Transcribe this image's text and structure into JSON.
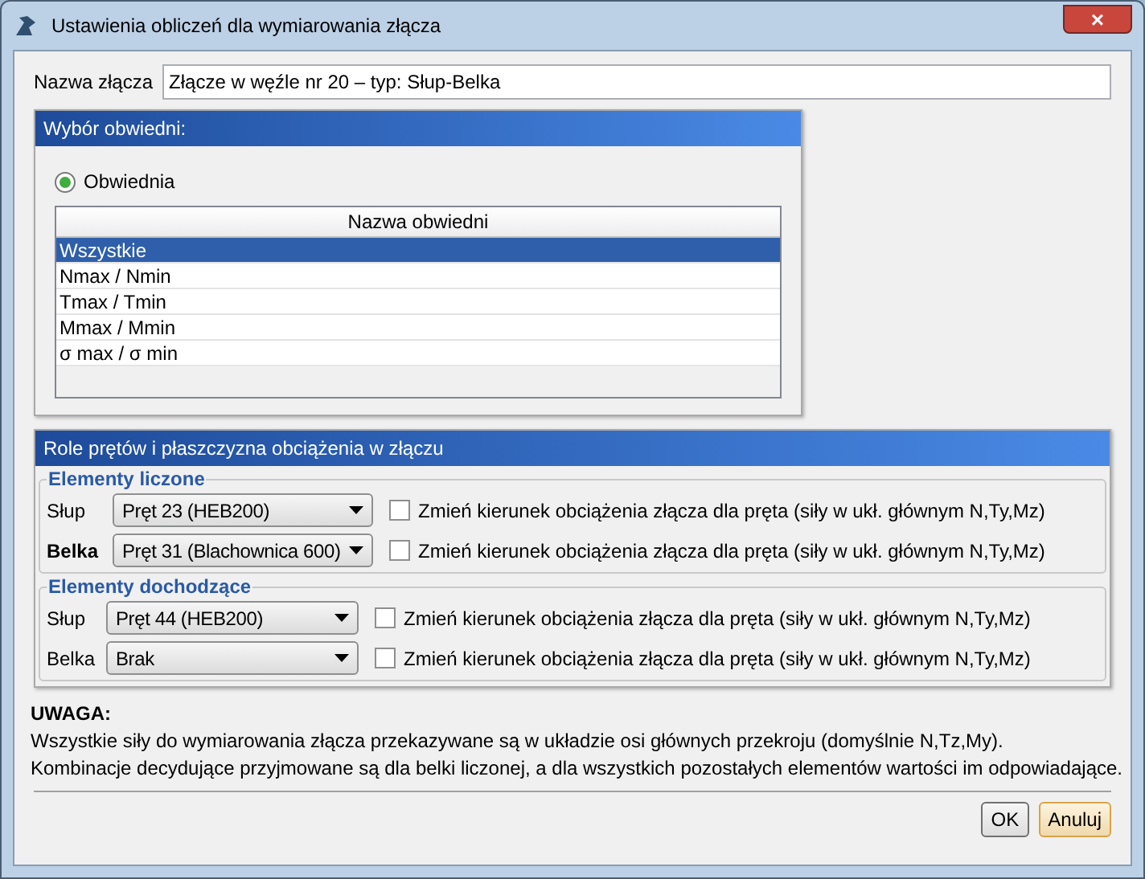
{
  "window": {
    "title": "Ustawienia obliczeń dla wymiarowania złącza",
    "close": "×"
  },
  "name_field": {
    "label": "Nazwa złącza",
    "value": "Złącze w węźle nr 20 – typ: Słup-Belka"
  },
  "envelope_panel": {
    "title": "Wybór obwiedni:",
    "radio": {
      "label": "Obwiednia",
      "selected": true
    },
    "table": {
      "columns": [
        "Nazwa obwiedni"
      ],
      "rows": [
        {
          "name": "Wszystkie",
          "selected": true
        },
        {
          "name": "Nmax / Nmin",
          "selected": false
        },
        {
          "name": "Tmax / Tmin",
          "selected": false
        },
        {
          "name": "Mmax / Mmin",
          "selected": false
        },
        {
          "name": "σ max / σ min",
          "selected": false
        }
      ]
    }
  },
  "roles_panel": {
    "title": "Role prętów i płaszczyzna obciążenia w złączu",
    "groups": [
      {
        "title": "Elementy liczone",
        "rows": [
          {
            "label": "Słup",
            "bold": false,
            "value": "Pręt 23 (HEB200)",
            "checked": false,
            "checkbox_label": "Zmień kierunek obciążenia złącza dla pręta (siły w ukł. głównym N,Ty,Mz)"
          },
          {
            "label": "Belka",
            "bold": true,
            "value": "Pręt 31 (Blachownica 600)",
            "checked": false,
            "checkbox_label": "Zmień kierunek obciążenia złącza dla pręta (siły w ukł. głównym N,Ty,Mz)"
          }
        ]
      },
      {
        "title": "Elementy dochodzące",
        "rows": [
          {
            "label": "Słup",
            "bold": false,
            "value": "Pręt 44 (HEB200)",
            "checked": false,
            "checkbox_label": "Zmień kierunek obciążenia złącza dla pręta (siły w ukł. głównym N,Ty,Mz)"
          },
          {
            "label": "Belka",
            "bold": false,
            "value": "Brak",
            "checked": false,
            "checkbox_label": "Zmień kierunek obciążenia złącza dla pręta (siły w ukł. głównym N,Ty,Mz)"
          }
        ]
      }
    ]
  },
  "note": {
    "title": "UWAGA:",
    "lines": [
      "Wszystkie siły do wymiarowania złącza przekazywane są w układzie osi głównych przekroju (domyślnie N,Tz,My).",
      "Kombinacje decydujące przyjmowane są dla belki liczonej, a dla wszystkich pozostałych elementów wartości im odpowiadające."
    ]
  },
  "buttons": [
    {
      "label": "OK",
      "focused": false
    },
    {
      "label": "Anuluj",
      "focused": true
    }
  ]
}
